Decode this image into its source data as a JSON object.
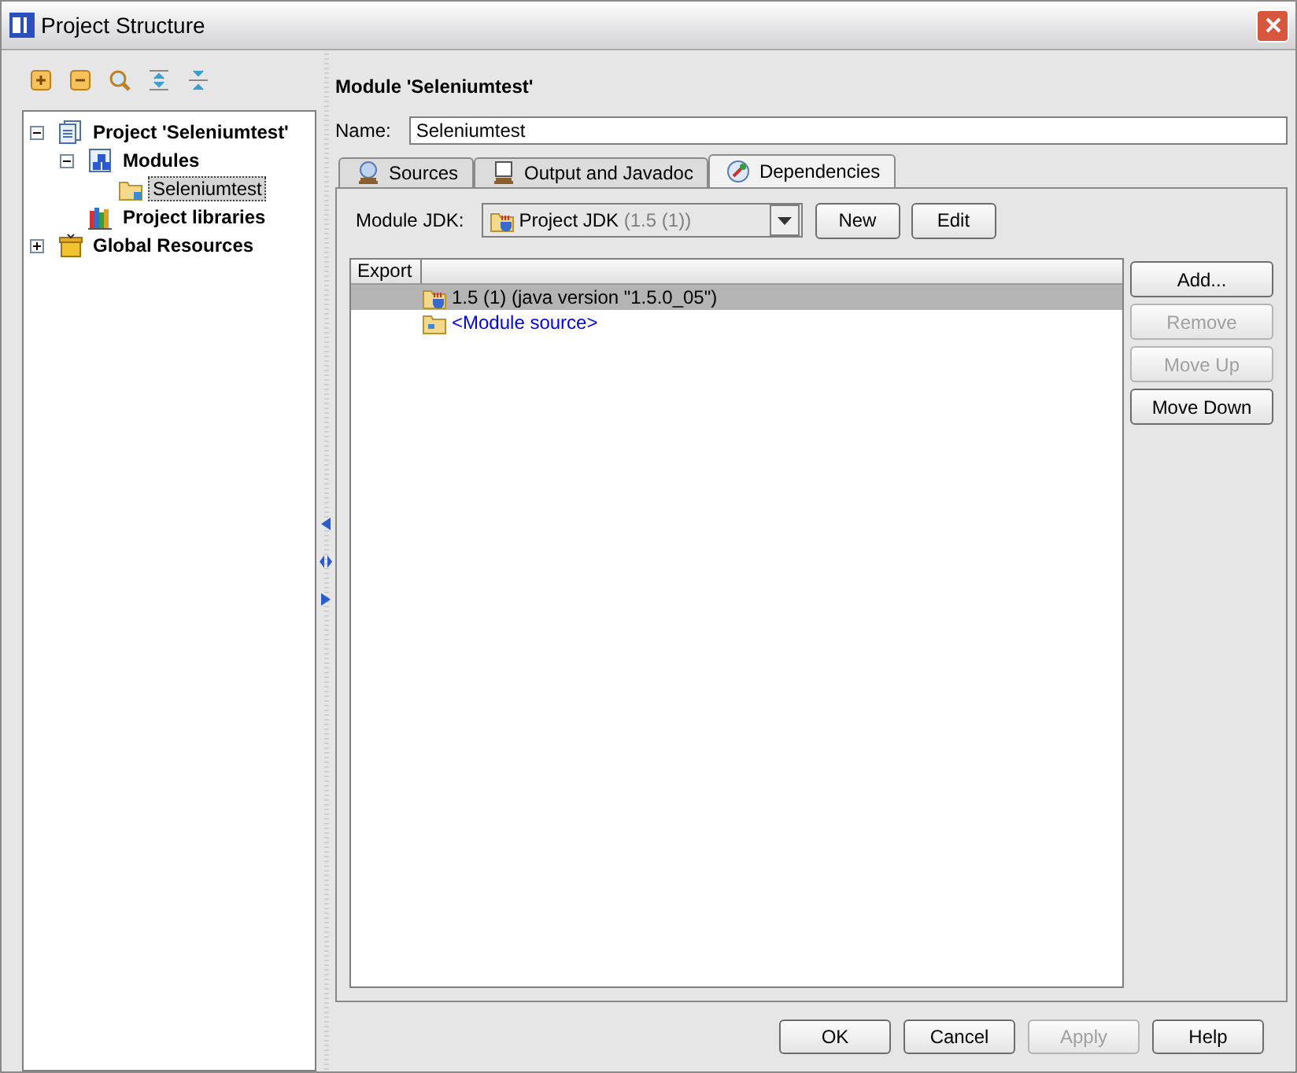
{
  "window": {
    "title": "Project Structure"
  },
  "toolbar": [
    {
      "kind": "add"
    },
    {
      "kind": "remove"
    },
    {
      "kind": "find"
    },
    {
      "kind": "expand"
    },
    {
      "kind": "collapse"
    }
  ],
  "tree": [
    {
      "label": "Project 'Seleniumtest'",
      "kind": "project",
      "expanded": true,
      "selected": false,
      "children": [
        {
          "label": "Modules",
          "kind": "modules",
          "expanded": true,
          "selected": false,
          "children": [
            {
              "label": "Seleniumtest",
              "kind": "module",
              "selected": true
            }
          ]
        },
        {
          "label": "Project libraries",
          "kind": "libraries",
          "selected": false
        }
      ]
    },
    {
      "label": "Global Resources",
      "kind": "resources",
      "expanded": false,
      "selected": false
    }
  ],
  "module": {
    "heading": "Module 'Seleniumtest'",
    "name_label": "Name:",
    "name": "Seleniumtest"
  },
  "tabs": [
    {
      "label": "Sources",
      "kind": "sources",
      "selected": false
    },
    {
      "label": "Output and Javadoc",
      "kind": "output",
      "selected": false
    },
    {
      "label": "Dependencies",
      "kind": "dependencies",
      "selected": true
    }
  ],
  "jdk": {
    "label": "Module JDK:",
    "value": "Project JDK",
    "detail": "(1.5 (1))",
    "buttons": [
      "New",
      "Edit"
    ]
  },
  "table": {
    "columns": [
      "Export"
    ],
    "rows": [
      {
        "text": "1.5 (1) (java version \"1.5.0_05\")",
        "kind": "jdk",
        "selected": true
      },
      {
        "text": "<Module source>",
        "kind": "source",
        "selected": false
      }
    ]
  },
  "side_buttons": [
    {
      "label": "Add...",
      "disabled": false
    },
    {
      "label": "Remove",
      "disabled": true
    },
    {
      "label": "Move Up",
      "disabled": true
    },
    {
      "label": "Move Down",
      "disabled": false
    }
  ],
  "buttons": [
    {
      "label": "OK",
      "disabled": false
    },
    {
      "label": "Cancel",
      "disabled": false
    },
    {
      "label": "Apply",
      "disabled": true
    },
    {
      "label": "Help",
      "disabled": false
    }
  ]
}
